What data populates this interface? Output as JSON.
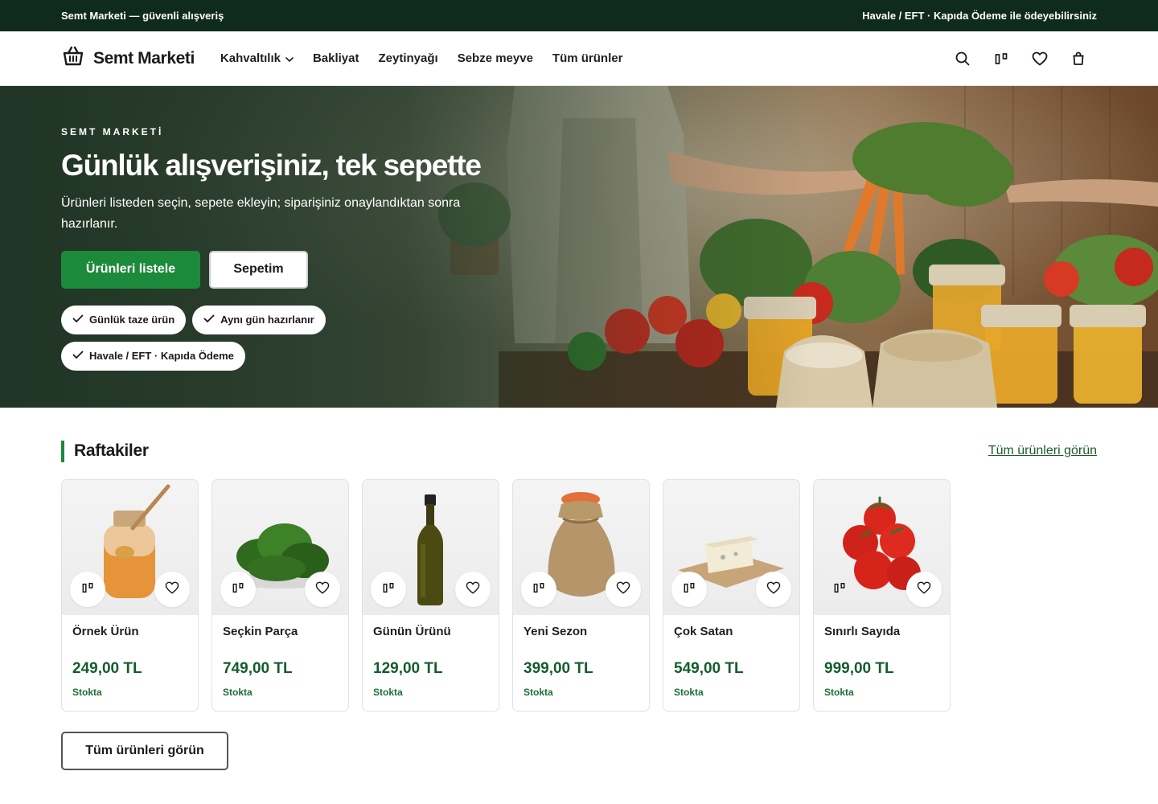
{
  "topbar": {
    "left": "Semt Marketi — güvenli alışveriş",
    "right": "Havale / EFT · Kapıda Ödeme ile ödeyebilirsiniz"
  },
  "header": {
    "brand": "Semt Marketi",
    "nav": [
      {
        "label": "Kahvaltılık",
        "has_dropdown": true
      },
      {
        "label": "Bakliyat"
      },
      {
        "label": "Zeytinyağı"
      },
      {
        "label": "Sebze meyve"
      },
      {
        "label": "Tüm ürünler"
      }
    ],
    "icons": [
      "search-icon",
      "compare-icon",
      "heart-icon",
      "bag-icon"
    ]
  },
  "hero": {
    "eyebrow": "SEMT MARKETİ",
    "title": "Günlük alışverişiniz, tek sepette",
    "subtitle": "Ürünleri listeden seçin, sepete ekleyin; siparişiniz onaylandıktan sonra hazırlanır.",
    "primary_button": "Ürünleri listele",
    "secondary_button": "Sepetim",
    "badges": [
      "Günlük taze ürün",
      "Aynı gün hazırlanır",
      "Havale / EFT · Kapıda Ödeme"
    ]
  },
  "section": {
    "title": "Raftakiler",
    "link": "Tüm ürünleri görün",
    "bottom_button": "Tüm ürünleri görün",
    "accent_color": "#1c8a3b"
  },
  "products": [
    {
      "name": "Örnek Ürün",
      "price": "249,00 TL",
      "stock": "Stokta",
      "image": "honey-jar"
    },
    {
      "name": "Seçkin Parça",
      "price": "749,00 TL",
      "stock": "Stokta",
      "image": "spinach"
    },
    {
      "name": "Günün Ürünü",
      "price": "129,00 TL",
      "stock": "Stokta",
      "image": "olive-oil-bottle"
    },
    {
      "name": "Yeni Sezon",
      "price": "399,00 TL",
      "stock": "Stokta",
      "image": "lentil-sack"
    },
    {
      "name": "Çok Satan",
      "price": "549,00 TL",
      "stock": "Stokta",
      "image": "cheese"
    },
    {
      "name": "Sınırlı Sayıda",
      "price": "999,00 TL",
      "stock": "Stokta",
      "image": "tomatoes"
    }
  ]
}
